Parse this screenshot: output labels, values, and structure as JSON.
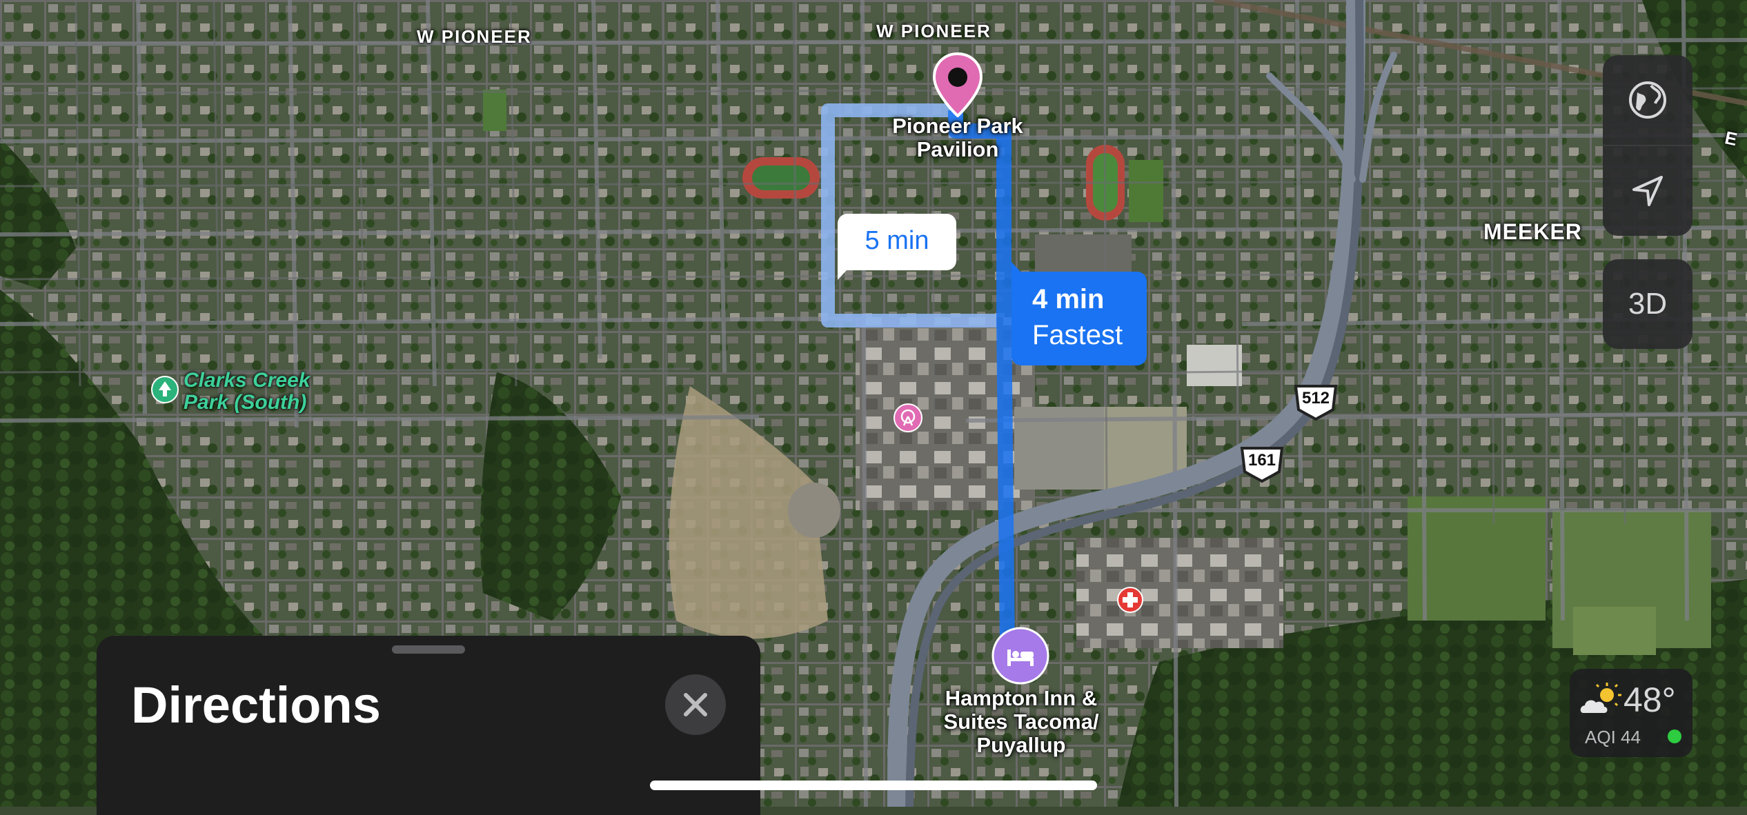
{
  "map": {
    "street_labels": [
      "W PIONEER",
      "W PIONEER",
      "MEEKER",
      "E"
    ],
    "destination": {
      "name_line1": "Pioneer Park",
      "name_line2": "Pavilion"
    },
    "origin": {
      "name_line1": "Hampton Inn &",
      "name_line2": "Suites Tacoma/",
      "name_line3": "Puyallup"
    },
    "park": {
      "name_line1": "Clarks Creek",
      "name_line2": "Park (South)"
    },
    "highways": [
      "512",
      "161"
    ],
    "route_alternate": {
      "time": "5 min"
    },
    "route_primary": {
      "time": "4 min",
      "note": "Fastest"
    },
    "colors": {
      "route_primary": "#1a73f2",
      "route_alternate": "#8db4ef",
      "destination_pin": "#e06bb3",
      "hotel_pin": "#a67ae8",
      "hospital": "#e53935"
    }
  },
  "controls": {
    "globe_icon": "globe-icon",
    "location_icon": "location-arrow-icon",
    "view_3d_label": "3D"
  },
  "weather": {
    "temperature": "48°",
    "aqi": "AQI 44",
    "icon": "partly-sunny-icon",
    "aqi_status_color": "#2ecc40"
  },
  "directions_sheet": {
    "title": "Directions",
    "close_icon": "close-icon"
  }
}
